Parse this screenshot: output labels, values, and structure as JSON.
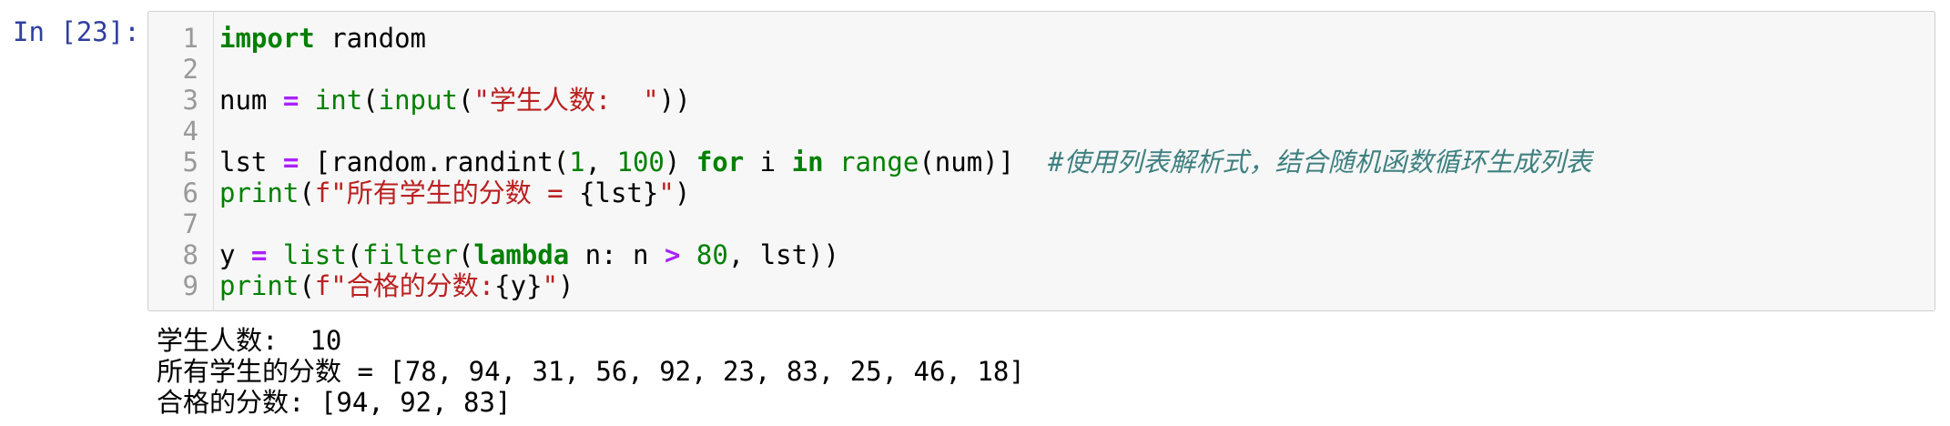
{
  "prompt": "In [23]:",
  "code": {
    "line_numbers": [
      "1",
      "2",
      "3",
      "4",
      "5",
      "6",
      "7",
      "8",
      "9"
    ],
    "line1": {
      "kw_import": "import",
      "rest": " random"
    },
    "line3": {
      "var": "num ",
      "eq": "=",
      "sp": " ",
      "int": "int",
      "p1": "(",
      "input": "input",
      "p2": "(",
      "str": "\"学生人数:  \"",
      "p3": "))"
    },
    "line5": {
      "var": "lst ",
      "eq": "=",
      "a": " [random.randint(",
      "n1": "1",
      "b": ", ",
      "n2": "100",
      "c": ") ",
      "for": "for",
      "d": " i ",
      "in": "in",
      "e": " ",
      "range": "range",
      "f": "(num)]",
      "comment": "#使用列表解析式，结合随机函数循环生成列表"
    },
    "line6": {
      "print": "print",
      "p1": "(",
      "fstr1": "f\"所有学生的分数 = ",
      "expr": "{lst}",
      "fstr2": "\"",
      "p2": ")"
    },
    "line8": {
      "var": "y ",
      "eq": "=",
      "sp": " ",
      "list": "list",
      "p1": "(",
      "filter": "filter",
      "p2": "(",
      "lambda": "lambda",
      "a": " n: n ",
      "gt": ">",
      "sp2": " ",
      "n80": "80",
      "b": ", lst))"
    },
    "line9": {
      "print": "print",
      "p1": "(",
      "fstr1": "f\"合格的分数:",
      "expr": "{y}",
      "fstr2": "\"",
      "p2": ")"
    }
  },
  "output": {
    "line1": "学生人数:  10",
    "line2": "所有学生的分数 = [78, 94, 31, 56, 92, 23, 83, 25, 46, 18]",
    "line3": "合格的分数: [94, 92, 83]"
  },
  "colors": {
    "prompt": "#303f9f",
    "keyword": "#008000",
    "operator": "#aa22ff",
    "string": "#ba2121",
    "comment": "#408080",
    "cell_bg": "#f7f7f7"
  }
}
